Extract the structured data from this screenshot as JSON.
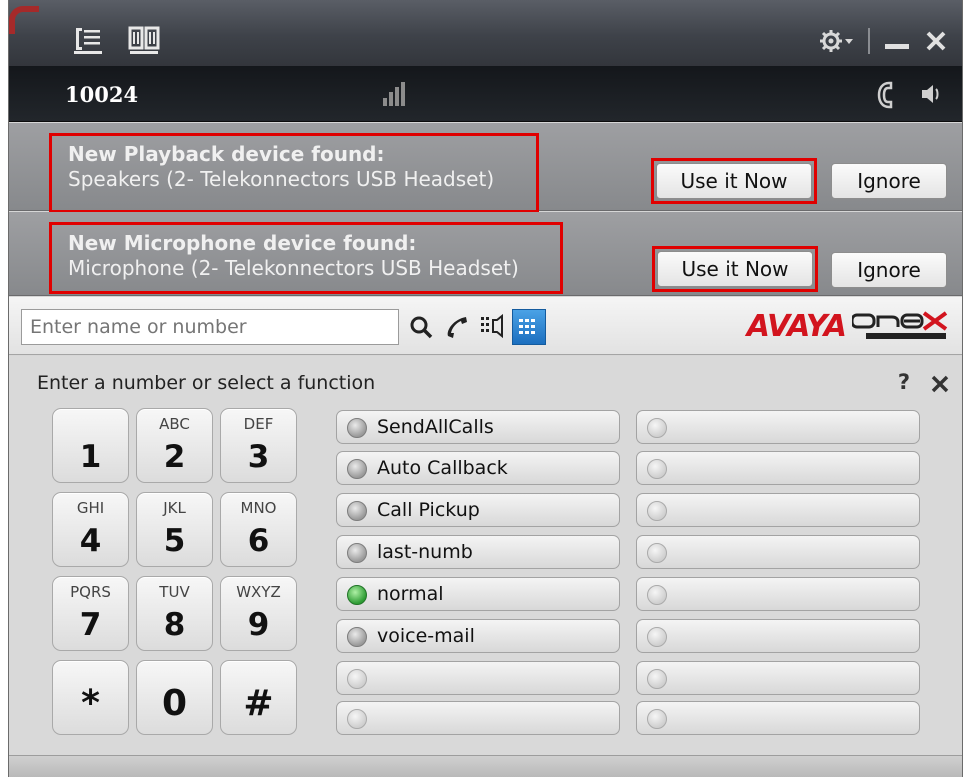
{
  "header": {
    "extension": "10024"
  },
  "notifications": [
    {
      "title": "New Playback device found:",
      "device": "Speakers (2- Telekonnectors USB Headset)",
      "use_label": "Use it Now",
      "ignore_label": "Ignore"
    },
    {
      "title": "New Microphone device found:",
      "device": "Microphone (2- Telekonnectors USB Headset)",
      "use_label": "Use it Now",
      "ignore_label": "Ignore"
    }
  ],
  "search": {
    "placeholder": "Enter name or number",
    "logo_text": "AVAYA"
  },
  "dialpad": {
    "hint": "Enter a number or select a function",
    "help": "?",
    "keys": [
      {
        "digit": "1",
        "letters": ""
      },
      {
        "digit": "2",
        "letters": "ABC"
      },
      {
        "digit": "3",
        "letters": "DEF"
      },
      {
        "digit": "4",
        "letters": "GHI"
      },
      {
        "digit": "5",
        "letters": "JKL"
      },
      {
        "digit": "6",
        "letters": "MNO"
      },
      {
        "digit": "7",
        "letters": "PQRS"
      },
      {
        "digit": "8",
        "letters": "TUV"
      },
      {
        "digit": "9",
        "letters": "WXYZ"
      },
      {
        "digit": "*",
        "letters": ""
      },
      {
        "digit": "0",
        "letters": ""
      },
      {
        "digit": "#",
        "letters": ""
      }
    ],
    "functions_left": [
      {
        "label": "SendAllCalls",
        "status": "off"
      },
      {
        "label": "Auto Callback",
        "status": "off"
      },
      {
        "label": "Call Pickup",
        "status": "off"
      },
      {
        "label": "last-numb",
        "status": "off"
      },
      {
        "label": "normal",
        "status": "on"
      },
      {
        "label": "voice-mail",
        "status": "off"
      },
      {
        "label": "",
        "status": "empty"
      },
      {
        "label": "",
        "status": "empty"
      }
    ],
    "functions_right": [
      {
        "label": "",
        "status": "empty"
      },
      {
        "label": "",
        "status": "empty"
      },
      {
        "label": "",
        "status": "empty"
      },
      {
        "label": "",
        "status": "empty"
      },
      {
        "label": "",
        "status": "empty"
      },
      {
        "label": "",
        "status": "empty"
      },
      {
        "label": "",
        "status": "empty"
      },
      {
        "label": "",
        "status": "empty"
      }
    ]
  },
  "colors": {
    "alert_border": "#e00000",
    "avaya_red": "#d2141e",
    "led_on": "#2e9c34"
  }
}
